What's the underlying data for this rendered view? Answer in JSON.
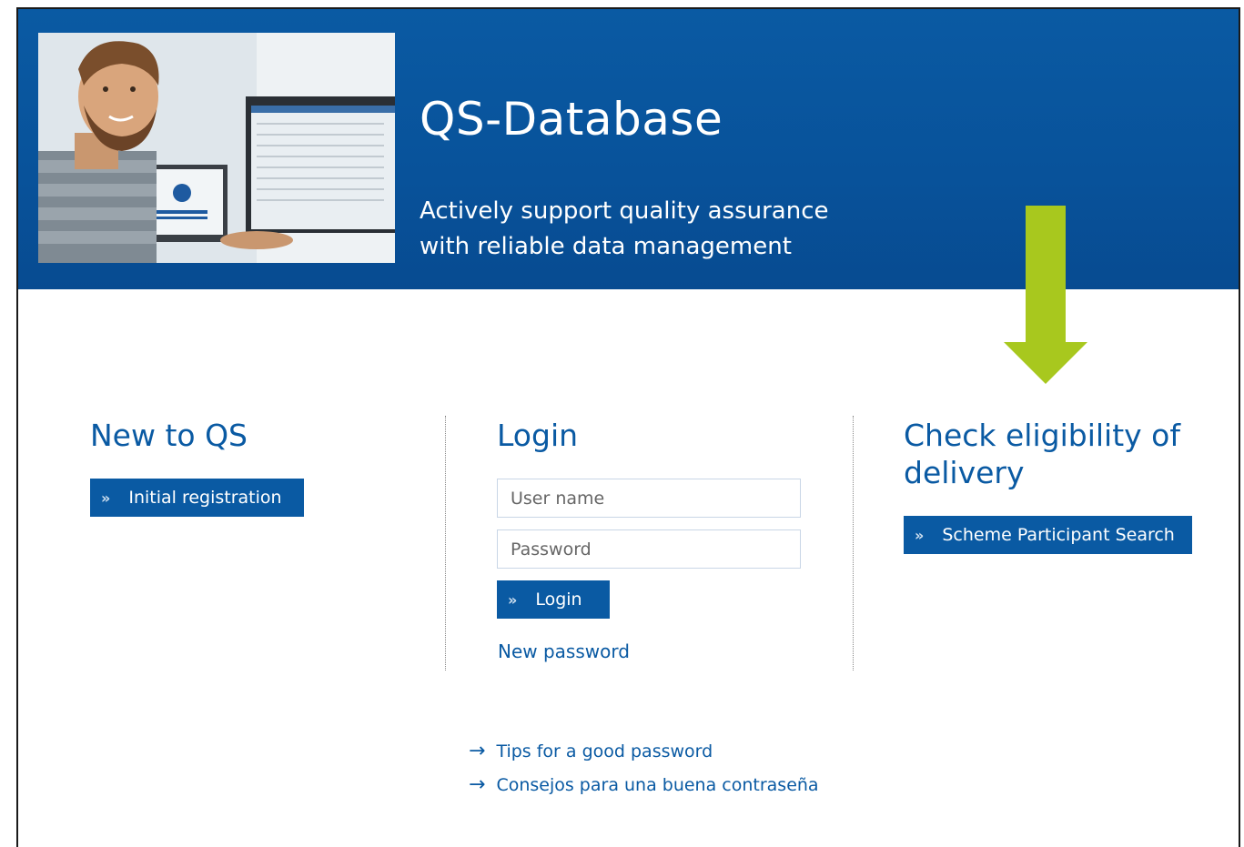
{
  "hero": {
    "title": "QS-Database",
    "subtitle_line1": "Actively support quality assurance",
    "subtitle_line2": "with reliable data management"
  },
  "new_to_qs": {
    "heading": "New to QS",
    "button_label": "Initial registration"
  },
  "login": {
    "heading": "Login",
    "username_placeholder": "User name",
    "password_placeholder": "Password",
    "button_label": "Login",
    "new_password_link": "New password"
  },
  "eligibility": {
    "heading_line1": "Check eligibility of",
    "heading_line2": "delivery",
    "button_label": "Scheme Participant Search"
  },
  "tips": [
    {
      "label": "Tips for a good password"
    },
    {
      "label": "Consejos para una buena contraseña"
    }
  ],
  "colors": {
    "brand_blue": "#0a5aa3",
    "highlight_arrow": "#a8c81e"
  },
  "icons": {
    "button_chevron": "double-chevron-right-icon",
    "link_arrow": "arrow-right-icon"
  }
}
